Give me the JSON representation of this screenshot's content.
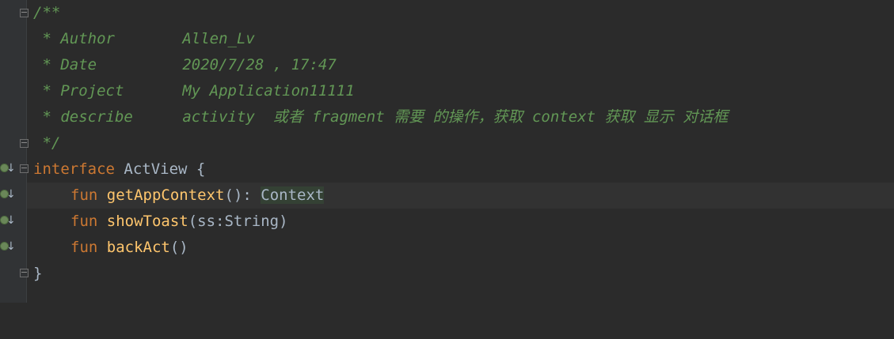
{
  "editor": {
    "lines": [
      {
        "text": "/**"
      },
      {
        "prefix": " * ",
        "tag": "Author",
        "value": "Allen_Lv"
      },
      {
        "prefix": " * ",
        "tag": "Date",
        "value": "2020/7/28 , 17:47"
      },
      {
        "prefix": " * ",
        "tag": "Project",
        "value": "My Application11111"
      },
      {
        "prefix": " * ",
        "tag": "describe",
        "value": "activity  或者 fragment 需要 的操作，获取 context 获取 显示 对话框"
      },
      {
        "text": " */"
      },
      {
        "kw": "interface",
        "name": "ActView",
        "rest": " {"
      },
      {
        "kw": "fun",
        "fn": "getAppContext",
        "paren": "(): ",
        "type": "Context"
      },
      {
        "kw": "fun",
        "fn": "showToast",
        "params": "(ss:String)"
      },
      {
        "kw": "fun",
        "fn": "backAct",
        "params": "()"
      },
      {
        "text": "}"
      }
    ]
  },
  "colors": {
    "background": "#2b2b2b",
    "comment": "#629755",
    "keyword": "#cc7832",
    "function": "#ffc66d",
    "plain": "#a9b7c6"
  },
  "icons": [
    "fold-icon",
    "implemented-method-icon"
  ]
}
